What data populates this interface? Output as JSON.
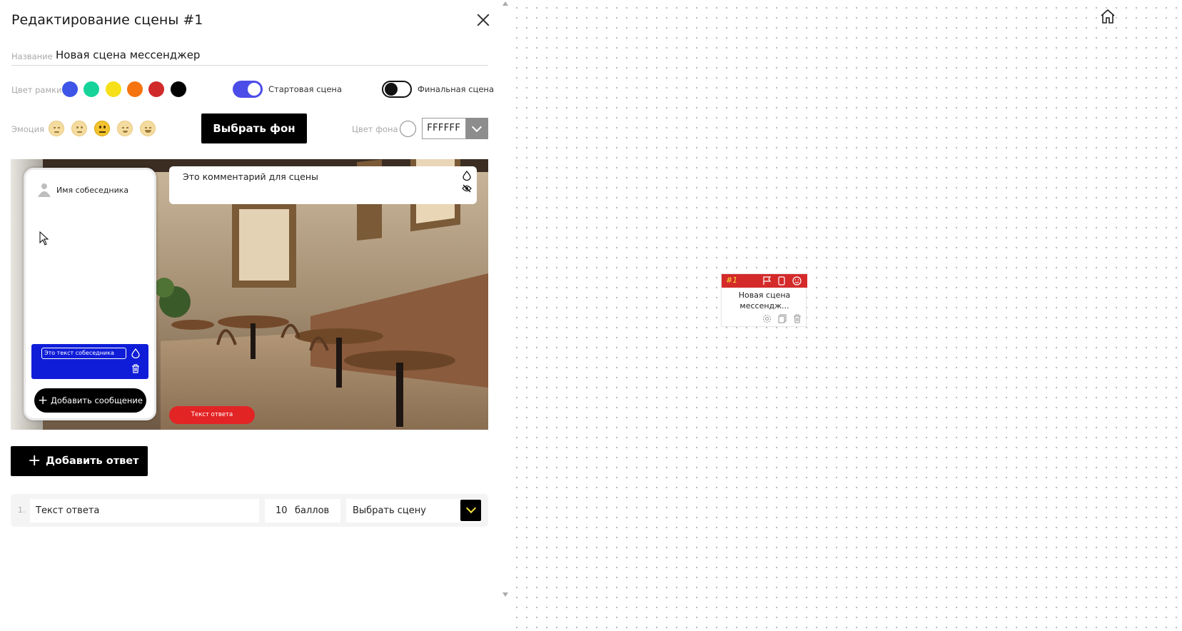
{
  "editor": {
    "title": "Редактирование сцены #1",
    "name_label": "Название",
    "name_value": "Новая сцена мессенджер",
    "frame_color_label": "Цвет рамки",
    "frame_colors": [
      "#3f55e8",
      "#16d39a",
      "#f5e01a",
      "#f57410",
      "#d12a2a",
      "#000000"
    ],
    "start_scene_label": "Стартовая сцена",
    "start_scene_on": true,
    "final_scene_label": "Финальная сцена",
    "final_scene_on": false,
    "emotion_label": "Эмоция",
    "emotions": [
      "crying-face-icon",
      "sad-face-icon",
      "neutral-face-icon",
      "smile-face-icon",
      "grin-face-icon"
    ],
    "selected_emotion": "neutral-face-icon",
    "choose_bg_button": "Выбрать фон",
    "bg_color_label": "Цвет фона",
    "bg_color_hex": "FFFFFF"
  },
  "preview": {
    "contact_name": "Имя собеседника",
    "message_text": "Это текст собеседника",
    "add_message_button": "Добавить сообщение",
    "comment_text": "Это комментарий для сцены",
    "answer_pill": "Текст ответа"
  },
  "answers": {
    "add_answer_button": "Добавить ответ",
    "items": [
      {
        "num": "1.",
        "text": "Текст ответа",
        "score": "10",
        "score_unit": "баллов",
        "scene_placeholder": "Выбрать сцену"
      }
    ]
  },
  "canvas": {
    "node": {
      "id": "#1",
      "title": "Новая сцена мессендж...",
      "header_color": "#d42a2a"
    }
  }
}
